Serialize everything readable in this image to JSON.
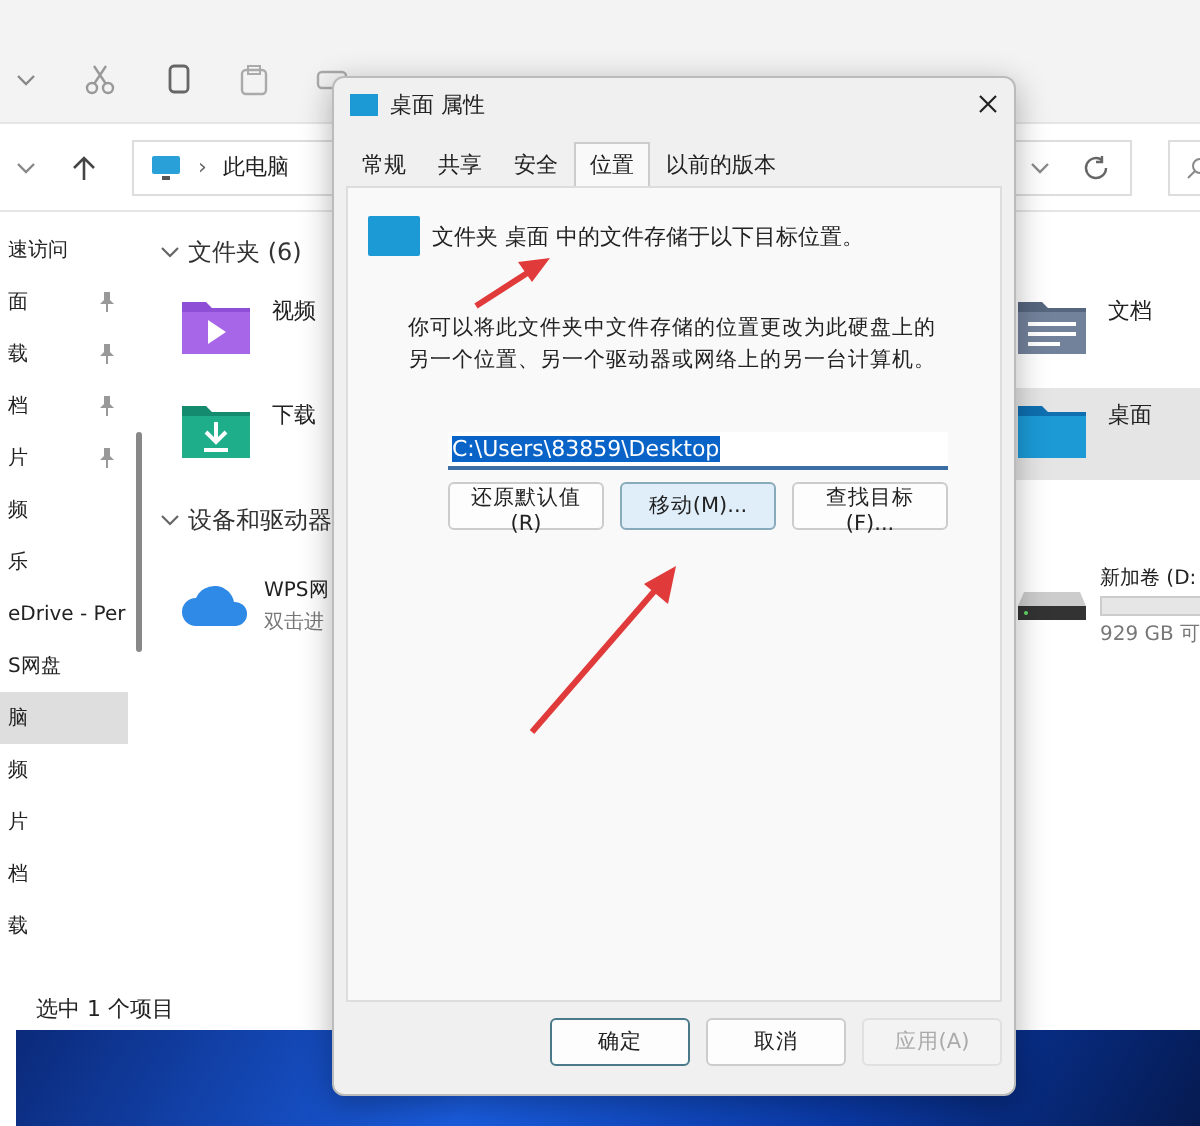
{
  "address_bar": {
    "separator": "›",
    "location": "此电脑"
  },
  "sidebar": {
    "items": [
      {
        "label": "速访问",
        "pinned": false,
        "selected": false
      },
      {
        "label": "面",
        "pinned": true,
        "selected": false
      },
      {
        "label": "载",
        "pinned": true,
        "selected": false
      },
      {
        "label": "档",
        "pinned": true,
        "selected": false
      },
      {
        "label": "片",
        "pinned": true,
        "selected": false
      },
      {
        "label": "频",
        "pinned": false,
        "selected": false
      },
      {
        "label": "乐",
        "pinned": false,
        "selected": false
      },
      {
        "label": "eDrive - Per",
        "pinned": false,
        "selected": false
      },
      {
        "label": "S网盘",
        "pinned": false,
        "selected": false
      },
      {
        "label": "脑",
        "pinned": false,
        "selected": true
      },
      {
        "label": "频",
        "pinned": false,
        "selected": false
      },
      {
        "label": "片",
        "pinned": false,
        "selected": false
      },
      {
        "label": "档",
        "pinned": false,
        "selected": false
      },
      {
        "label": "载",
        "pinned": false,
        "selected": false
      }
    ]
  },
  "folders": {
    "title": "文件夹 (6)",
    "items": [
      {
        "label": "视频",
        "kind": "video",
        "selected": false
      },
      {
        "label": "文档",
        "kind": "documents",
        "selected": false
      },
      {
        "label": "下载",
        "kind": "downloads",
        "selected": false
      },
      {
        "label": "桌面",
        "kind": "desktop",
        "selected": true
      }
    ]
  },
  "devices": {
    "title": "设备和驱动器",
    "items": [
      {
        "label": "WPS网",
        "detail": "双击进",
        "kind": "cloud"
      },
      {
        "label": "新加卷 (D:",
        "detail": "929 GB 可",
        "kind": "drive"
      }
    ]
  },
  "status_bar": {
    "text": "选中 1 个项目"
  },
  "dialog": {
    "title": "桌面 属性",
    "tabs": [
      {
        "label": "常规",
        "selected": false
      },
      {
        "label": "共享",
        "selected": false
      },
      {
        "label": "安全",
        "selected": false
      },
      {
        "label": "位置",
        "selected": true
      },
      {
        "label": "以前的版本",
        "selected": false
      }
    ],
    "info": "文件夹 桌面 中的文件存储于以下目标位置。",
    "description": "你可以将此文件夹中文件存储的位置更改为此硬盘上的另一个位置、另一个驱动器或网络上的另一台计算机。",
    "path": {
      "value": "C:\\Users\\83859\\Desktop",
      "text_selected": true
    },
    "actions": [
      {
        "label": "还原默认值(R)",
        "highlighted": false
      },
      {
        "label": "移动(M)...",
        "highlighted": true
      },
      {
        "label": "查找目标(F)...",
        "highlighted": false
      }
    ],
    "buttons": [
      {
        "label": "确定",
        "default": true,
        "disabled": false
      },
      {
        "label": "取消",
        "default": false,
        "disabled": false
      },
      {
        "label": "应用(A)",
        "default": false,
        "disabled": true
      }
    ]
  }
}
